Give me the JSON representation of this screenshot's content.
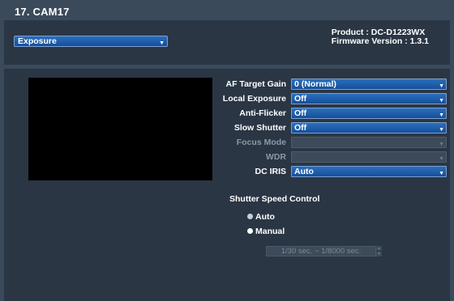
{
  "window": {
    "title": "17. CAM17"
  },
  "header": {
    "page_select": "Exposure",
    "product_line": "Product : DC-D1223WX",
    "firmware_line": "Firmware Version : 1.3.1"
  },
  "settings": {
    "af_target_gain": {
      "label": "AF Target Gain",
      "value": "0 (Normal)"
    },
    "local_exposure": {
      "label": "Local Exposure",
      "value": "Off"
    },
    "anti_flicker": {
      "label": "Anti-Flicker",
      "value": "Off"
    },
    "slow_shutter": {
      "label": "Slow Shutter",
      "value": "Off"
    },
    "focus_mode": {
      "label": "Focus Mode",
      "value": ""
    },
    "wdr": {
      "label": "WDR",
      "value": ""
    },
    "dc_iris": {
      "label": "DC IRIS",
      "value": "Auto"
    }
  },
  "shutter": {
    "title": "Shutter Speed Control",
    "auto_label": "Auto",
    "manual_label": "Manual",
    "selected": "Manual",
    "range_value": "1/30 sec. ~ 1/8000 sec."
  },
  "icons": {
    "dropdown": "chevron-down-icon",
    "radio": "radio-icon",
    "spinner_up": "spinner-up-icon",
    "spinner_down": "spinner-down-icon"
  },
  "colors": {
    "background": "#3b4a5b",
    "panel": "#2a3644",
    "select_blue": "#1e5fae",
    "disabled": "#3d4a59"
  }
}
